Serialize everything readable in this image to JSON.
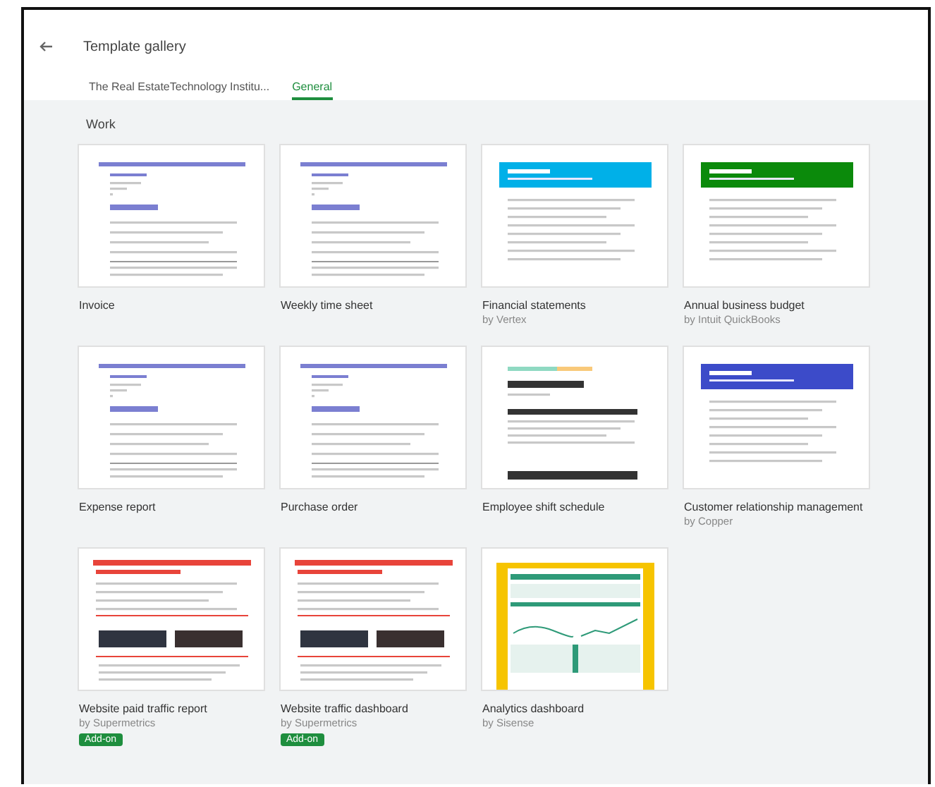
{
  "header": {
    "title": "Template gallery"
  },
  "tabs": [
    {
      "label": "The Real EstateTechnology Institu...",
      "selected": false
    },
    {
      "label": "General",
      "selected": true
    }
  ],
  "section": {
    "title": "Work"
  },
  "templates": [
    {
      "name": "Invoice",
      "thumbnail": {
        "kind": "letterhead",
        "color": "#7b7fd1"
      }
    },
    {
      "name": "Weekly time sheet",
      "thumbnail": {
        "kind": "letterhead",
        "color": "#7b7fd1"
      }
    },
    {
      "name": "Financial statements",
      "author": "by Vertex",
      "thumbnail": {
        "kind": "banner",
        "color": "#00b0e8"
      }
    },
    {
      "name": "Annual business budget",
      "author": "by Intuit QuickBooks",
      "thumbnail": {
        "kind": "banner",
        "color": "#0b8a0b"
      }
    },
    {
      "name": "Expense report",
      "thumbnail": {
        "kind": "letterhead",
        "color": "#7b7fd1"
      }
    },
    {
      "name": "Purchase order",
      "thumbnail": {
        "kind": "letterhead",
        "color": "#7b7fd1"
      }
    },
    {
      "name": "Employee shift schedule",
      "thumbnail": {
        "kind": "schedule",
        "color": "#333333"
      }
    },
    {
      "name": "Customer relationship management",
      "author": "by Copper",
      "thumbnail": {
        "kind": "banner",
        "color": "#3c4bc9"
      }
    },
    {
      "name": "Website paid traffic report",
      "author": "by Supermetrics",
      "badge": "Add-on",
      "thumbnail": {
        "kind": "report",
        "color": "#e8443a"
      }
    },
    {
      "name": "Website traffic dashboard",
      "author": "by Supermetrics",
      "badge": "Add-on",
      "thumbnail": {
        "kind": "report",
        "color": "#e8443a"
      }
    },
    {
      "name": "Analytics dashboard",
      "author": "by Sisense",
      "thumbnail": {
        "kind": "dashboard",
        "color": "#f6c400"
      }
    }
  ]
}
